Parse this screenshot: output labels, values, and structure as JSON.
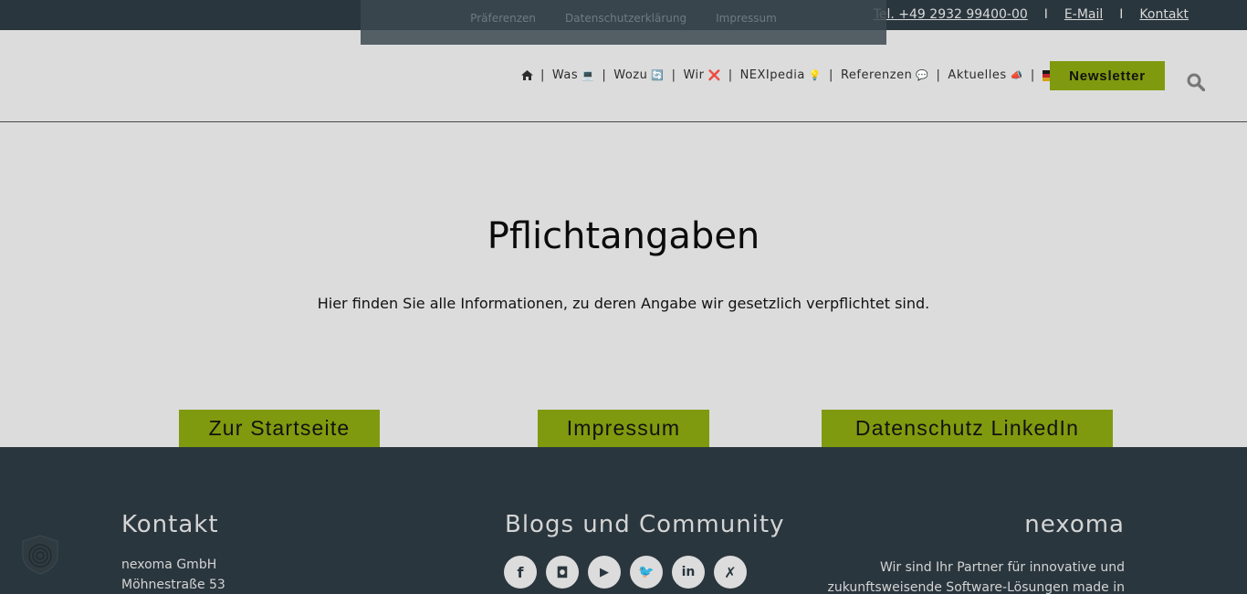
{
  "topbar": {
    "phone": "Tel. +49 2932 99400-00",
    "separator": "I",
    "email": "E-Mail",
    "contact": "Kontakt"
  },
  "cookie_panel": {
    "links": [
      "Präferenzen",
      "Datenschutzerklärung",
      "Impressum"
    ]
  },
  "nav": {
    "home_icon": "home-icon",
    "items": [
      {
        "label": "Was",
        "emoji": "💻"
      },
      {
        "label": "Wozu",
        "emoji": "🔄"
      },
      {
        "label": "Wir",
        "emoji": "❌"
      },
      {
        "label": "NEXIpedia",
        "emoji": "💡"
      },
      {
        "label": "Referenzen",
        "emoji": "💬"
      },
      {
        "label": "Aktuelles",
        "emoji": "📣"
      }
    ],
    "pipe": "|",
    "language_flag": "de-flag-icon",
    "newsletter_label": "Newsletter",
    "search_icon": "search-icon"
  },
  "main": {
    "title": "Pflichtangaben",
    "subtitle": "Hier finden Sie alle Informationen, zu deren Angabe wir gesetzlich verpflichtet sind.",
    "buttons": [
      "Zur Startseite",
      "Impressum",
      "Datenschutz LinkedIn"
    ]
  },
  "footer": {
    "kontakt": {
      "heading": "Kontakt",
      "lines": [
        "nexoma GmbH",
        "Möhnestraße 53"
      ]
    },
    "blogs": {
      "heading": "Blogs und Community",
      "socials": [
        {
          "icon": "facebook-icon",
          "glyph": "f"
        },
        {
          "icon": "instagram-icon",
          "glyph": "◘"
        },
        {
          "icon": "youtube-icon",
          "glyph": "▶"
        },
        {
          "icon": "twitter-icon",
          "glyph": "🐦"
        },
        {
          "icon": "linkedin-icon",
          "glyph": "in"
        },
        {
          "icon": "xing-icon",
          "glyph": "✗"
        }
      ]
    },
    "nexoma": {
      "heading": "nexoma",
      "about": "Wir sind Ihr Partner für innovative und zukunftsweisende Software-Lösungen made in"
    }
  },
  "colors": {
    "topbar": "#2a363e",
    "accent": "#7f9a0e",
    "overlay_bg": "#dcdcdc"
  }
}
